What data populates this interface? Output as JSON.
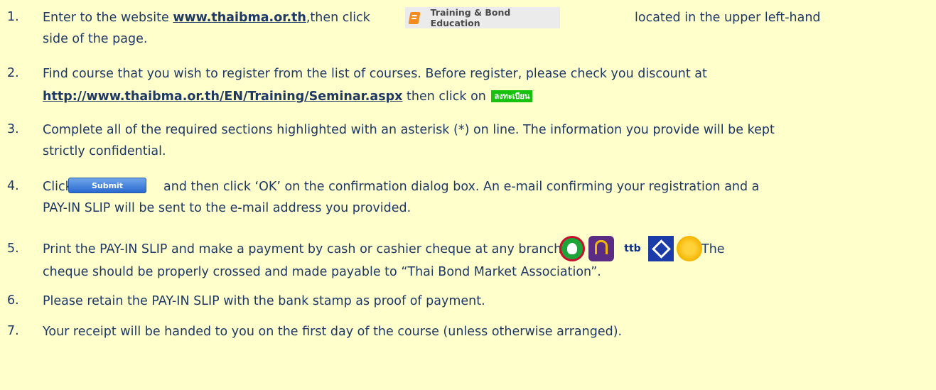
{
  "steps": [
    {
      "num": "1.",
      "pre": "Enter to the website ",
      "link": "www.thaibma.or.th",
      "mid": ",then click ",
      "button": "Training & Bond Education",
      "post": "located in the upper left-hand",
      "cont": "side of the page."
    },
    {
      "num": "2.",
      "text": "Find course that you wish to register from the list of courses. Before register, please check you discount at",
      "link": "http://www.thaibma.or.th/EN/Training/Seminar.aspx",
      "post": " then click on ",
      "button": "ลงทะเบียน"
    },
    {
      "num": "3.",
      "text": "Complete all of the required sections highlighted with an asterisk (*) on line. The information you provide will be kept",
      "cont": "strictly confidential."
    },
    {
      "num": "4.",
      "pre": "Click",
      "button": "Submit",
      "post": "and then click ‘OK’ on the confirmation dialog box. An e-mail confirming your registration and a",
      "cont": "PAY-IN SLIP will be sent to the e-mail address you provided."
    },
    {
      "num": "5.",
      "pre": "Print the PAY-IN SLIP and make a payment by cash or cashier cheque at any branch of",
      "banks": [
        "kasikorn-bank-logo",
        "scb-logo",
        "ttb-logo",
        "bangkok-bank-logo",
        "krungsri-logo"
      ],
      "ttb_text": "ttb",
      "post": "The",
      "cont": "cheque should be properly crossed and made payable to “Thai Bond Market Association”."
    },
    {
      "num": "6.",
      "text": "Please retain the PAY-IN SLIP with the bank stamp as proof of payment."
    },
    {
      "num": "7.",
      "text": "Your receipt will be handed to you on the first day of the course (unless otherwise arranged)."
    }
  ],
  "colors": {
    "background": "#ffffcc",
    "text": "#1f3864",
    "thai_button": "#19c10f",
    "submit_button": "#2a6ad1",
    "book_icon": "#f28c1e"
  }
}
